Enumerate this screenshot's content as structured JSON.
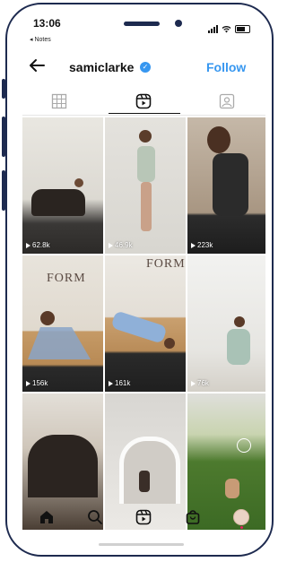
{
  "status_bar": {
    "time": "13:06",
    "back_app": "◂ Notes"
  },
  "header": {
    "username": "samiclarke",
    "follow_label": "Follow",
    "verified_glyph": "✓"
  },
  "tabs": [
    {
      "name": "grid-icon",
      "active": false
    },
    {
      "name": "reels-icon",
      "active": true
    },
    {
      "name": "tagged-icon",
      "active": false
    }
  ],
  "reels": [
    {
      "views": "62.8k"
    },
    {
      "views": "46.9k"
    },
    {
      "views": "223k"
    },
    {
      "views": "156k",
      "overlay": "FORM"
    },
    {
      "views": "161k",
      "overlay": "FORM"
    },
    {
      "views": "76k"
    },
    {
      "views": ""
    },
    {
      "views": ""
    },
    {
      "views": ""
    }
  ],
  "bottom_nav": [
    {
      "name": "home-icon"
    },
    {
      "name": "search-icon"
    },
    {
      "name": "reels-nav-icon"
    },
    {
      "name": "shop-icon"
    },
    {
      "name": "profile-avatar"
    }
  ]
}
